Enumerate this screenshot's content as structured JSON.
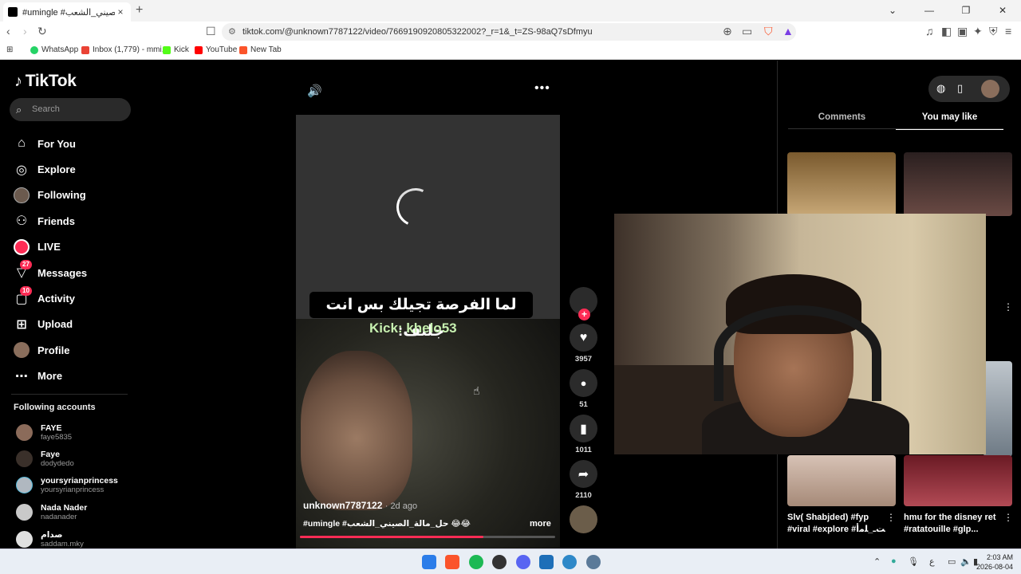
{
  "browser": {
    "tab_title": "#umingle #حل_مالة_الصيني_الشعب",
    "tab_close": "×",
    "new_tab": "+",
    "url": "tiktok.com/@unknown7787122/video/7669190920805322002?_r=1&_t=ZS-98aQ7sDfmyu",
    "window_controls": [
      "⌄",
      "—",
      "❐",
      "✕"
    ]
  },
  "bookmarks": [
    {
      "label": "WhatsApp",
      "color": "#25d366"
    },
    {
      "label": "Inbox (1,779) - mmi...",
      "color": "#ea4335"
    },
    {
      "label": "Kick",
      "color": "#53fc18"
    },
    {
      "label": "YouTube",
      "color": "#ff0000"
    },
    {
      "label": "New Tab",
      "color": "#fb542b"
    }
  ],
  "sidebar": {
    "logo": "TikTok",
    "search_placeholder": "Search",
    "menu": [
      {
        "label": "For You",
        "icon": "home-icon",
        "glyph": "⌂"
      },
      {
        "label": "Explore",
        "icon": "compass-icon",
        "glyph": "◎"
      },
      {
        "label": "Following",
        "icon": "avatar-icon",
        "glyph": ""
      },
      {
        "label": "Friends",
        "icon": "friends-icon",
        "glyph": "⚇"
      },
      {
        "label": "LIVE",
        "icon": "live-icon",
        "glyph": ""
      },
      {
        "label": "Messages",
        "icon": "messages-icon",
        "glyph": "▽",
        "badge": "27"
      },
      {
        "label": "Activity",
        "icon": "activity-icon",
        "glyph": "▢",
        "badge": "10"
      },
      {
        "label": "Upload",
        "icon": "upload-icon",
        "glyph": "⊞"
      },
      {
        "label": "Profile",
        "icon": "profile-icon",
        "glyph": ""
      },
      {
        "label": "More",
        "icon": "more-icon",
        "glyph": "⋯"
      }
    ],
    "following_title": "Following accounts",
    "following": [
      {
        "name": "FAYE",
        "handle": "faye5835",
        "color": "#8b6b5a"
      },
      {
        "name": "Faye",
        "handle": "dodydedo",
        "color": "#3a302a"
      },
      {
        "name": "yoursyrianprincess",
        "handle": "yoursyrianprincess",
        "color": "#b0b8c0"
      },
      {
        "name": "Nada Nader",
        "handle": "nadanader",
        "color": "#c9c9c9"
      },
      {
        "name": "صدام",
        "handle": "saddam.mky",
        "color": "#e0e0e0"
      }
    ]
  },
  "video": {
    "caption": "لما الفرصة تجيلك بس انت جلنف:",
    "overlay_text": "Kick: khelo53",
    "username": "unknown7787122",
    "posted": "· 2d ago",
    "description": "#umingle #حل_مالة_الصيني_الشعب 😂😂 ...",
    "more": "more",
    "progress": 0.72,
    "actions": [
      {
        "name": "like",
        "glyph": "♥",
        "count": "3957"
      },
      {
        "name": "comment",
        "glyph": "💬",
        "count": "51"
      },
      {
        "name": "bookmark",
        "glyph": "▮",
        "count": "1011"
      },
      {
        "name": "share",
        "glyph": "➦",
        "count": "2110"
      }
    ]
  },
  "right_panel": {
    "tabs": [
      "Comments",
      "You may like"
    ],
    "active_tab": "You may like",
    "items": [
      {
        "title": "Slv( Shabjded) #fyp #viral #explore #ﺖـ_ﻠﻣأ"
      },
      {
        "title": "hmu for the disney ret #ratatouille #glp..."
      }
    ]
  },
  "taskbar": {
    "time": "2:03 AM",
    "date": "2026-08-04",
    "lang": "ع"
  }
}
